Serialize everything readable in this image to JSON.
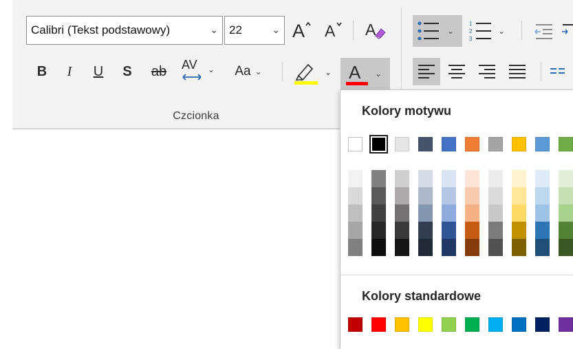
{
  "ribbon": {
    "group_label": "Czcionka",
    "font_name": "Calibri (Tekst podstawowy)",
    "font_size": "22",
    "bold": "B",
    "italic": "I",
    "underline": "U",
    "shadow": "S",
    "strikethrough": "ab",
    "char_spacing": "AV",
    "change_case": "Aa"
  },
  "palette": {
    "theme_title": "Kolory motywu",
    "standard_title": "Kolory standardowe",
    "theme_colors": [
      "#ffffff",
      "#000000",
      "#e7e6e6",
      "#44546a",
      "#4472c4",
      "#ed7d31",
      "#a5a5a5",
      "#ffc000",
      "#5b9bd5",
      "#70ad47"
    ],
    "theme_shades": [
      [
        "#f2f2f2",
        "#d9d9d9",
        "#bfbfbf",
        "#a6a6a6",
        "#808080"
      ],
      [
        "#808080",
        "#595959",
        "#404040",
        "#262626",
        "#0d0d0d"
      ],
      [
        "#d0cece",
        "#aeaaaa",
        "#767171",
        "#3b3838",
        "#171616"
      ],
      [
        "#d6dce5",
        "#adb9ca",
        "#8497b0",
        "#333f50",
        "#222a35"
      ],
      [
        "#dae3f3",
        "#b4c7e7",
        "#8faadc",
        "#2f5597",
        "#203864"
      ],
      [
        "#fbe5d6",
        "#f8cbad",
        "#f4b183",
        "#c55a11",
        "#843c0c"
      ],
      [
        "#ededed",
        "#dbdbdb",
        "#c9c9c9",
        "#7b7b7b",
        "#525252"
      ],
      [
        "#fff2cc",
        "#ffe699",
        "#ffd966",
        "#bf9000",
        "#7f6000"
      ],
      [
        "#deebf7",
        "#bdd7ee",
        "#9dc3e6",
        "#2e75b6",
        "#1f4e79"
      ],
      [
        "#e2f0d9",
        "#c5e0b4",
        "#a9d18e",
        "#548235",
        "#385723"
      ]
    ],
    "standard_colors": [
      "#c00000",
      "#ff0000",
      "#ffc000",
      "#ffff00",
      "#92d050",
      "#00b050",
      "#00b0f0",
      "#0070c0",
      "#002060",
      "#7030a0"
    ],
    "selected_index": 1
  },
  "accents": {
    "highlight_bar": "#ffff00",
    "font_color_bar": "#ff0000",
    "list_icon_blue": "#2b6cb0"
  }
}
